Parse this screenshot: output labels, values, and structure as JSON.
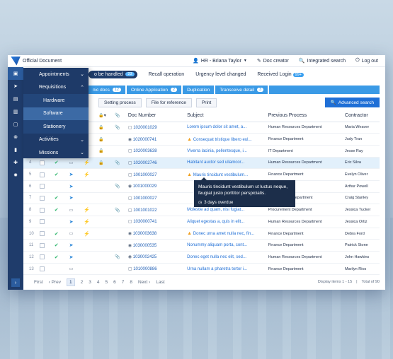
{
  "app": {
    "title": "Official Document"
  },
  "topbar": {
    "user": "HR - Briana Taylor",
    "doc_creator": "Doc creator",
    "integrated_search": "Integrated search",
    "logout": "Log out"
  },
  "menu": {
    "items": [
      {
        "label": "Appointments",
        "chevron": "down"
      },
      {
        "label": "Requisitions",
        "chevron": "up"
      },
      {
        "label": "Hardware"
      },
      {
        "label": "Software"
      },
      {
        "label": "Stationery"
      },
      {
        "label": "Activities",
        "chevron": "down"
      },
      {
        "label": "Missions",
        "chevron": "down"
      }
    ]
  },
  "tabs1": {
    "active": {
      "label": "o be handled",
      "count": "23"
    },
    "recall": "Recall operation",
    "urgency": "Urgency level changed",
    "received": {
      "label": "Received Login",
      "count": "99+"
    }
  },
  "tabs2": [
    {
      "label": "nic docs",
      "count": "12"
    },
    {
      "label": "Online Application",
      "count": "2"
    },
    {
      "label": "Duplication",
      "count": ""
    },
    {
      "label": "Transceive detail",
      "count": "3"
    }
  ],
  "toolbar": {
    "setting": "Setting process",
    "file": "File for reference",
    "print": "Print",
    "advanced": "Advanced search"
  },
  "columns": {
    "doc_number": "Doc Number",
    "subject": "Subject",
    "previous_process": "Previous Process",
    "contractor": "Contractor"
  },
  "rows": [
    {
      "n": "",
      "doc": "1020001029",
      "subject": "Lorem ipsum dolor sit amet, a...",
      "dept": "Human Resources Department",
      "contractor": "Maria Weaver"
    },
    {
      "n": "",
      "doc": "1020000741",
      "subject": "Consequat tristique libero eul...",
      "dept": "Finance Department",
      "contractor": "Judy Tran"
    },
    {
      "n": "",
      "doc": "1020003638",
      "subject": "Viverra lacinia, pellentesque, i...",
      "dept": "IT Department",
      "contractor": "Jesse Ray"
    },
    {
      "n": "4",
      "doc": "1020002746",
      "subject": "Habitant auctor sed ullamcor...",
      "dept": "Human Resources Department",
      "contractor": "Eric Silva"
    },
    {
      "n": "5",
      "doc": "1001000027",
      "subject": "Mauris tincidunt vestibulum...",
      "dept": "Finance Department",
      "contractor": "Evelyn Oliver"
    },
    {
      "n": "6",
      "doc": "1001000029",
      "subject": "",
      "dept": "nt",
      "contractor": "Arthur Powell"
    },
    {
      "n": "7",
      "doc": "1001000027",
      "subject": "",
      "dept": "Development Department",
      "contractor": "Craig Stanley"
    },
    {
      "n": "8",
      "doc": "1001001022",
      "subject": "Molestie ad quam, nisi fugiat...",
      "dept": "Procurement Department",
      "contractor": "Jessica Tucker"
    },
    {
      "n": "9",
      "doc": "1030000741",
      "subject": "Aliquet egestas a, quis in elit...",
      "dept": "Human Resources Department",
      "contractor": "Jessica Ortiz"
    },
    {
      "n": "10",
      "doc": "1030003638",
      "subject": "Donec urna amet nulla nec, fin...",
      "dept": "Finance Department",
      "contractor": "Debra Ford"
    },
    {
      "n": "11",
      "doc": "1030000535",
      "subject": "Nonummy aliquam porta, cont...",
      "dept": "Finance Department",
      "contractor": "Patrick Stone"
    },
    {
      "n": "12",
      "doc": "1030002425",
      "subject": "Donec eget nulla nec elit, sed...",
      "dept": "Human Resources Department",
      "contractor": "John Hawkins"
    },
    {
      "n": "13",
      "doc": "1010000886",
      "subject": "Urna nullam a pharetra tortor i...",
      "dept": "Finance Department",
      "contractor": "Marilyn Rios"
    }
  ],
  "tooltip": {
    "text": "Mauris tincidunt vestibulum ut luctus neque, feugiat justo porttitor perspiciatis.",
    "overdue": "3 days overdue"
  },
  "pager": {
    "first": "First",
    "prev": "Prev",
    "pages": [
      "1",
      "2",
      "3",
      "4",
      "5",
      "6",
      "7",
      "8"
    ],
    "next": "Next",
    "last": "Last",
    "items": "Display items 1 - 15",
    "total": "Total of 90"
  }
}
